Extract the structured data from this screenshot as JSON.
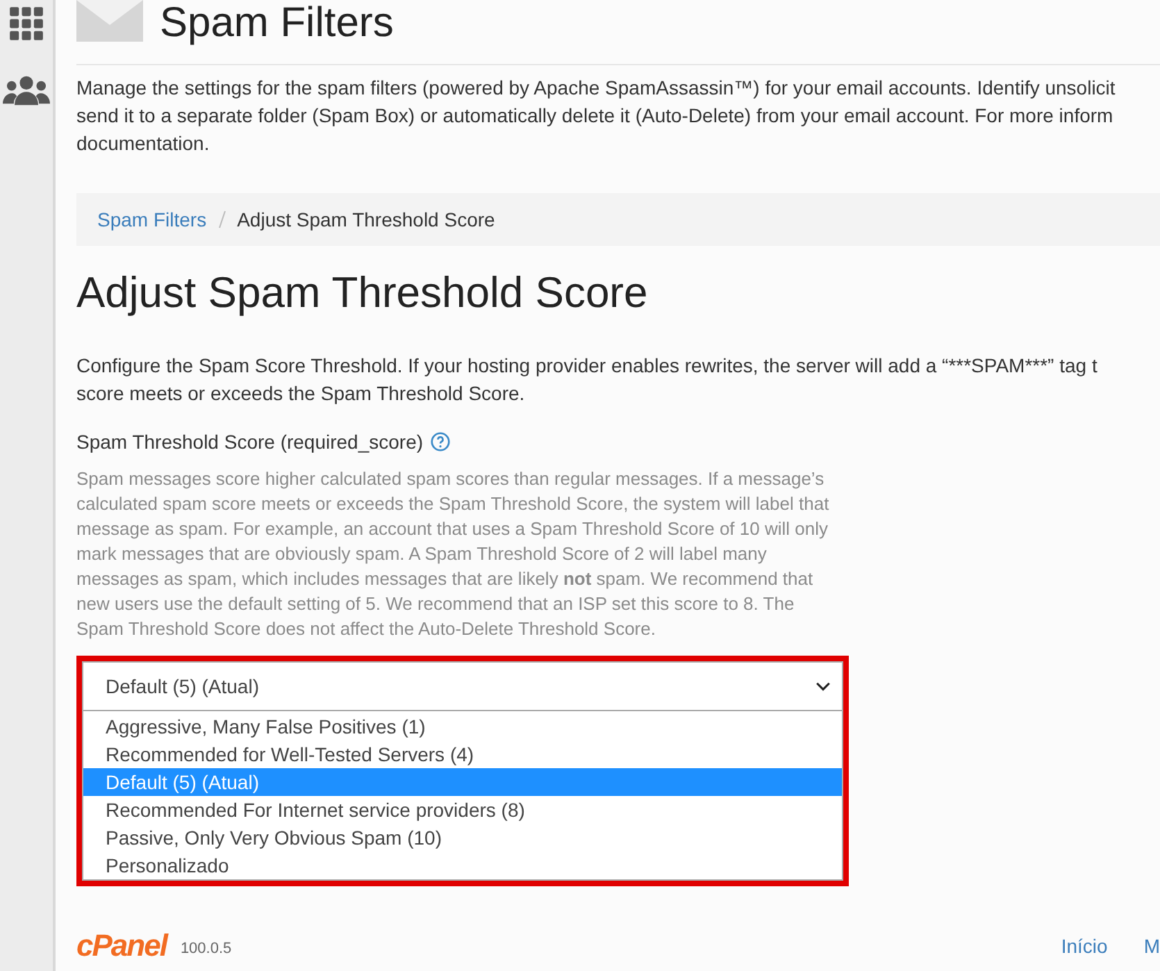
{
  "page_title": "Spam Filters",
  "intro_lines": [
    "Manage the settings for the spam filters (powered by Apache SpamAssassin™) for your email accounts. Identify unsolicit",
    "send it to a separate folder (Spam Box) or automatically delete it (Auto-Delete) from your email account. For more inform",
    "documentation."
  ],
  "breadcrumb": [
    {
      "label": "Spam Filters",
      "kind": "link"
    },
    {
      "label": "Adjust Spam Threshold Score",
      "kind": "current"
    }
  ],
  "heading": "Adjust Spam Threshold Score",
  "configure_lines": [
    "Configure the Spam Score Threshold. If your hosting provider enables rewrites, the server will add a “***SPAM***” tag t",
    "score meets or exceeds the Spam Threshold Score."
  ],
  "field": {
    "label": "Spam Threshold Score (required_score)",
    "help": "Spam messages score higher calculated spam scores than regular messages. If a message’s calculated spam score meets or exceeds the Spam Threshold Score, the system will label that message as spam. For example, an account that uses a Spam Threshold Score of 10 will only mark messages that are obviously spam. A Spam Threshold Score of 2 will label many messages as spam, which includes messages that are likely **not** spam. We recommend that new users use the default setting of 5. We recommend that an ISP set this score to 8. The Spam Threshold Score does not affect the Auto-Delete Threshold Score.",
    "value": "Default (5) (Atual)",
    "options": [
      {
        "label": "Aggressive, Many False Positives (1)",
        "selected": false
      },
      {
        "label": "Recommended for Well-Tested Servers (4)",
        "selected": false
      },
      {
        "label": "Default (5) (Atual)",
        "selected": true
      },
      {
        "label": "Recommended For Internet service providers (8)",
        "selected": false
      },
      {
        "label": "Passive, Only Very Obvious Spam (10)",
        "selected": false
      },
      {
        "label": "Personalizado",
        "selected": false
      }
    ]
  },
  "footer": {
    "logo": "cPanel",
    "version": "100.0.5",
    "links": [
      "Início",
      "M"
    ]
  }
}
